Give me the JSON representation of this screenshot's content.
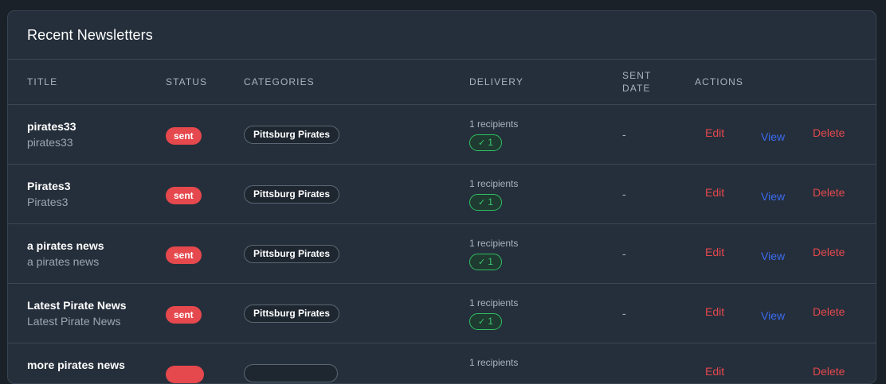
{
  "card": {
    "title": "Recent Newsletters"
  },
  "columns": {
    "title": "TITLE",
    "status": "STATUS",
    "categories": "CATEGORIES",
    "delivery": "DELIVERY",
    "sent_date_line1": "SENT",
    "sent_date_line2": "DATE",
    "actions": "ACTIONS"
  },
  "rows": [
    {
      "title": "pirates33",
      "subtitle": "pirates33",
      "status": "sent",
      "category": "Pittsburg Pirates",
      "recipients": "1 recipients",
      "delivered": "1",
      "sent_date": "-",
      "edit": "Edit",
      "view": "View",
      "delete": "Delete"
    },
    {
      "title": "Pirates3",
      "subtitle": "Pirates3",
      "status": "sent",
      "category": "Pittsburg Pirates",
      "recipients": "1 recipients",
      "delivered": "1",
      "sent_date": "-",
      "edit": "Edit",
      "view": "View",
      "delete": "Delete"
    },
    {
      "title": "a pirates news",
      "subtitle": "a pirates news",
      "status": "sent",
      "category": "Pittsburg Pirates",
      "recipients": "1 recipients",
      "delivered": "1",
      "sent_date": "-",
      "edit": "Edit",
      "view": "View",
      "delete": "Delete"
    },
    {
      "title": "Latest Pirate News",
      "subtitle": "Latest Pirate News",
      "status": "sent",
      "category": "Pittsburg Pirates",
      "recipients": "1 recipients",
      "delivered": "1",
      "sent_date": "-",
      "edit": "Edit",
      "view": "View",
      "delete": "Delete"
    },
    {
      "title": "more pirates news",
      "subtitle": "",
      "status": "",
      "category": "",
      "recipients": "1 recipients",
      "delivered": "",
      "sent_date": "",
      "edit": "Edit",
      "view": "",
      "delete": "Delete"
    }
  ],
  "colors": {
    "status_sent": "#e5484d",
    "delivered_ok": "#38c870",
    "view_link": "#3b6bf0",
    "danger": "#e5484d"
  },
  "icons": {
    "delivered": "check-icon"
  }
}
